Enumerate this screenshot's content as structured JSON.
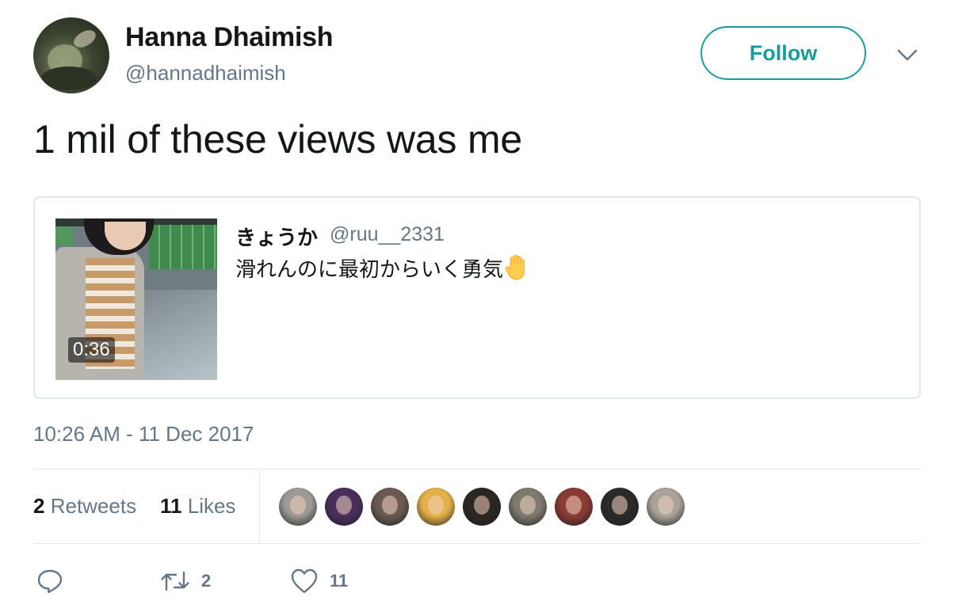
{
  "author": {
    "display_name": "Hanna Dhaimish",
    "handle": "@hannadhaimish",
    "avatar_icon": "avatar-photo"
  },
  "follow_button": {
    "label": "Follow",
    "color": "#1a9c9a"
  },
  "more_menu_icon": "chevron-down-icon",
  "tweet": {
    "text": "1 mil of these views was me",
    "timestamp": "10:26 AM - 11 Dec 2017"
  },
  "quoted_tweet": {
    "name": "きょうか",
    "handle": "@ruu__2331",
    "text": "滑れんのに最初からいく勇気",
    "emoji_icon": "raised-hand-icon",
    "video_duration": "0:36"
  },
  "stats": {
    "retweets_count": "2",
    "retweets_label": "Retweets",
    "likes_count": "11",
    "likes_label": "Likes",
    "liker_avatars": [
      {
        "name": "liker-avatar-1",
        "color": "#9d9a95"
      },
      {
        "name": "liker-avatar-2",
        "color": "#4a2f5e"
      },
      {
        "name": "liker-avatar-3",
        "color": "#6b5a52"
      },
      {
        "name": "liker-avatar-4",
        "color": "#e4b04a"
      },
      {
        "name": "liker-avatar-5",
        "color": "#2b2622"
      },
      {
        "name": "liker-avatar-6",
        "color": "#7f7a70"
      },
      {
        "name": "liker-avatar-7",
        "color": "#8a3b35"
      },
      {
        "name": "liker-avatar-8",
        "color": "#2a2a2a"
      },
      {
        "name": "liker-avatar-9",
        "color": "#a9a39c"
      }
    ]
  },
  "actions": {
    "reply_icon": "reply-icon",
    "retweet_icon": "retweet-icon",
    "retweet_count": "2",
    "like_icon": "heart-icon",
    "like_count": "11"
  },
  "colors": {
    "text_primary": "#14171a",
    "text_secondary": "#657786",
    "border": "#e1e8ed",
    "accent": "#1a9c9a"
  }
}
